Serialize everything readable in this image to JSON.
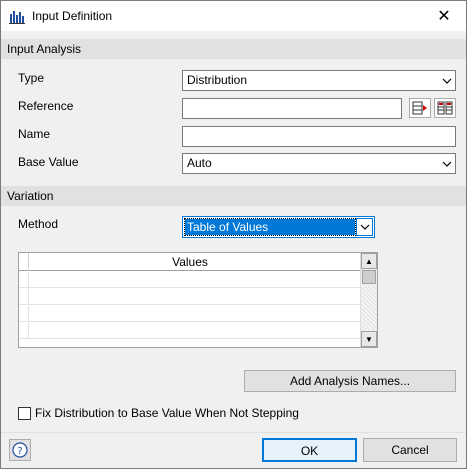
{
  "window": {
    "title": "Input Definition",
    "close_glyph": "✕"
  },
  "input_analysis": {
    "header": "Input Analysis",
    "type_label": "Type",
    "type_value": "Distribution",
    "reference_label": "Reference",
    "reference_value": "",
    "name_label": "Name",
    "name_value": "",
    "base_value_label": "Base Value",
    "base_value_value": "Auto"
  },
  "variation": {
    "header": "Variation",
    "method_label": "Method",
    "method_value": "Table of Values",
    "grid": {
      "column_header": "Values",
      "rows": [
        "",
        "",
        "",
        "",
        ""
      ]
    }
  },
  "buttons": {
    "add_analysis_names": "Add Analysis Names...",
    "ok": "OK",
    "cancel": "Cancel",
    "help_glyph": "?"
  },
  "checkbox": {
    "label": "Fix Distribution to Base Value When Not Stepping",
    "checked": false
  },
  "colors": {
    "accent": "#0078d7",
    "section_header": "#e1e1e1"
  },
  "icons": [
    "bar-chart-app-icon",
    "close-icon",
    "reference-select-icon",
    "range-select-icon",
    "chevron-down-icon",
    "help-icon"
  ]
}
